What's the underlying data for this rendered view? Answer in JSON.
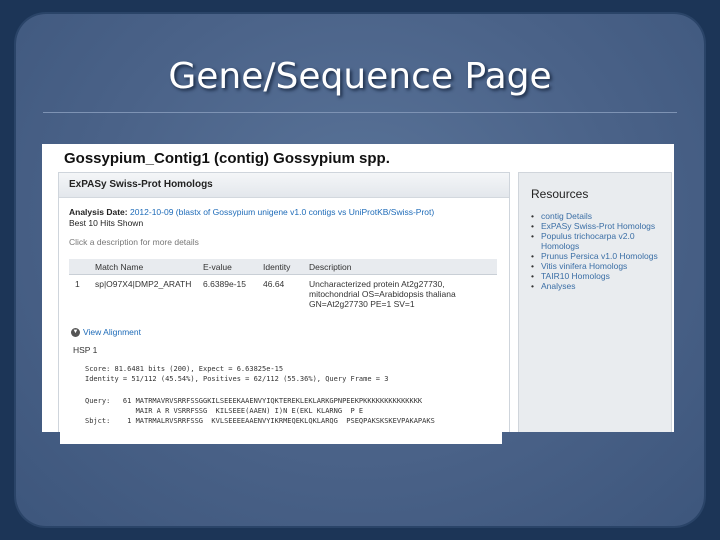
{
  "slide": {
    "title": "Gene/Sequence Page"
  },
  "page": {
    "heading": "Gossypium_Contig1 (contig) Gossypium spp.",
    "homologs": {
      "panel_title": "ExPASy Swiss-Prot Homologs",
      "analysis_label": "Analysis Date:",
      "analysis_text": "2012-10-09 (blastx of Gossypium unigene v1.0 contigs vs UniProtKB/Swiss-Prot)",
      "hits_text": "Best 10 Hits Shown",
      "instruction": "Click a description for more details",
      "columns": [
        "Match Name",
        "E-value",
        "Identity",
        "Description"
      ],
      "rows": [
        {
          "num": "1",
          "match": "sp|O97X4|DMP2_ARATH",
          "evalue": "6.6389e-15",
          "identity": "46.64",
          "description_lines": [
            "Uncharacterized protein At2g27730,",
            "mitochondrial OS=Arabidopsis thaliana",
            "GN=At2g27730 PE=1 SV=1"
          ]
        }
      ],
      "view_alignment": "View Alignment",
      "hsp_label": "HSP 1",
      "alignment_lines": [
        "Score: 81.6481 bits (200), Expect = 6.63825e-15",
        "Identity = 51/112 (45.54%), Positives = 62/112 (55.36%), Query Frame = 3",
        "",
        "Query:   61 MATRMAVRVSRRFSSGGKILSEEEKAAENVYIQKTEREKLEKLARKGPNPEEKPKKKKKKKKKKKKKK",
        "            MAIR A R VSRRFSSG  KILSEEE(AAEN) I)N E(EKL KLARNG  P E",
        "Sbjct:    1 MATRMALRVSRRFSSG  KVLSEEEEAAENVYIKRMEQEKLQKLARQG  PSEQPAKSKSKEVPAKAPAKS"
      ]
    },
    "resources": {
      "title": "Resources",
      "items": [
        "contig Details",
        "ExPASy Swiss-Prot Homologs",
        "Populus trichocarpa v2.0 Homologs",
        "Prunus Persica v1.0 Homologs",
        "Vitis vinifera Homologs",
        "TAIR10 Homologs",
        "Analyses"
      ]
    }
  }
}
